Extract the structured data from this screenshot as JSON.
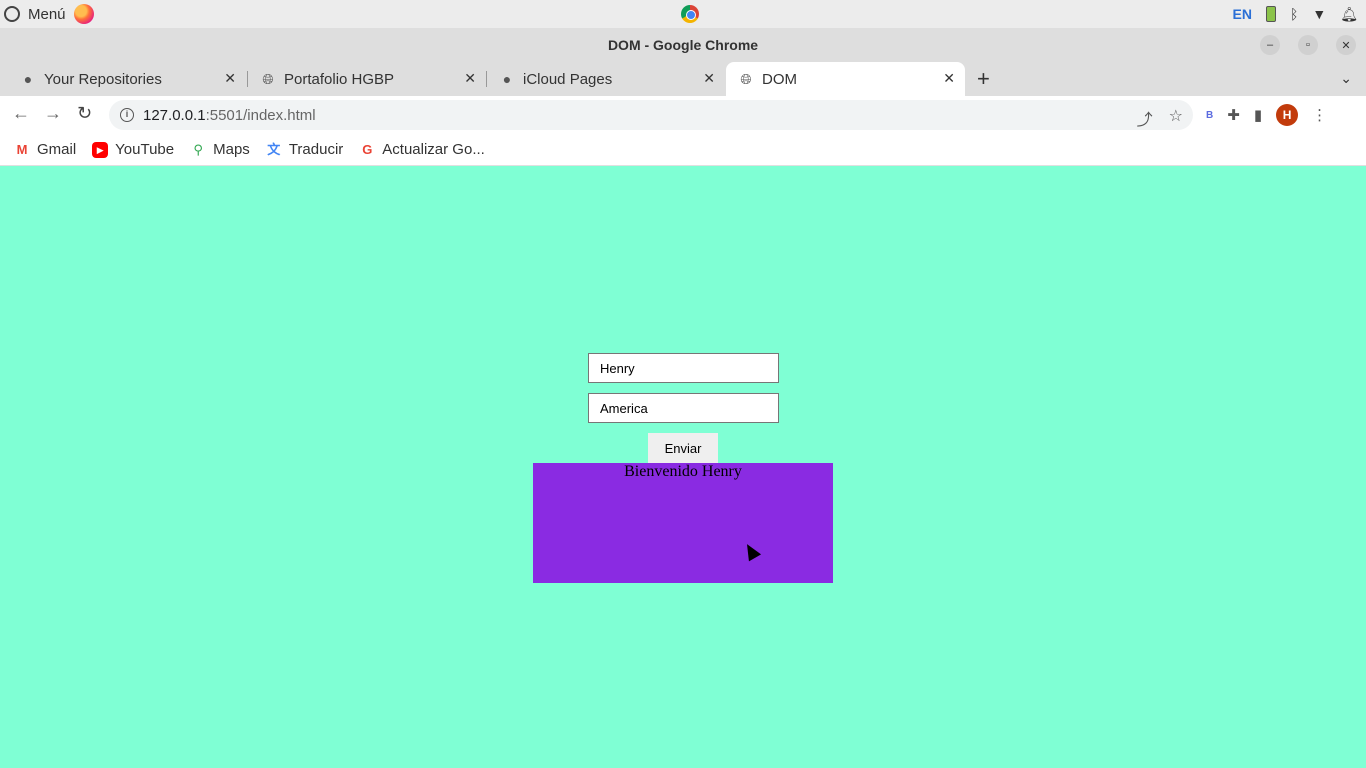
{
  "os": {
    "menu_label": "Menú",
    "keyboard_layout": "EN"
  },
  "window": {
    "title": "DOM - Google Chrome"
  },
  "tabs": [
    {
      "label": "Your Repositories",
      "icon": "github-icon"
    },
    {
      "label": "Portafolio HGBP",
      "icon": "globe-icon"
    },
    {
      "label": "iCloud Pages",
      "icon": "apple-icon"
    },
    {
      "label": "DOM",
      "icon": "globe-icon",
      "active": true
    }
  ],
  "toolbar": {
    "url_host": "127.0.0.1",
    "url_path": ":5501/index.html",
    "profile_initial": "H",
    "extension_label": "B"
  },
  "bookmarks": [
    {
      "label": "Gmail",
      "icon": "gmail-icon"
    },
    {
      "label": "YouTube",
      "icon": "youtube-icon"
    },
    {
      "label": "Maps",
      "icon": "maps-icon"
    },
    {
      "label": "Traducir",
      "icon": "translate-icon"
    },
    {
      "label": "Actualizar Go...",
      "icon": "google-icon"
    }
  ],
  "form": {
    "name_value": "Henry",
    "country_value": "America",
    "submit_label": "Enviar"
  },
  "output": {
    "greeting": "Bienvenido Henry"
  },
  "colors": {
    "page_background": "#7fffd4",
    "greeting_box": "#8a2be2"
  }
}
